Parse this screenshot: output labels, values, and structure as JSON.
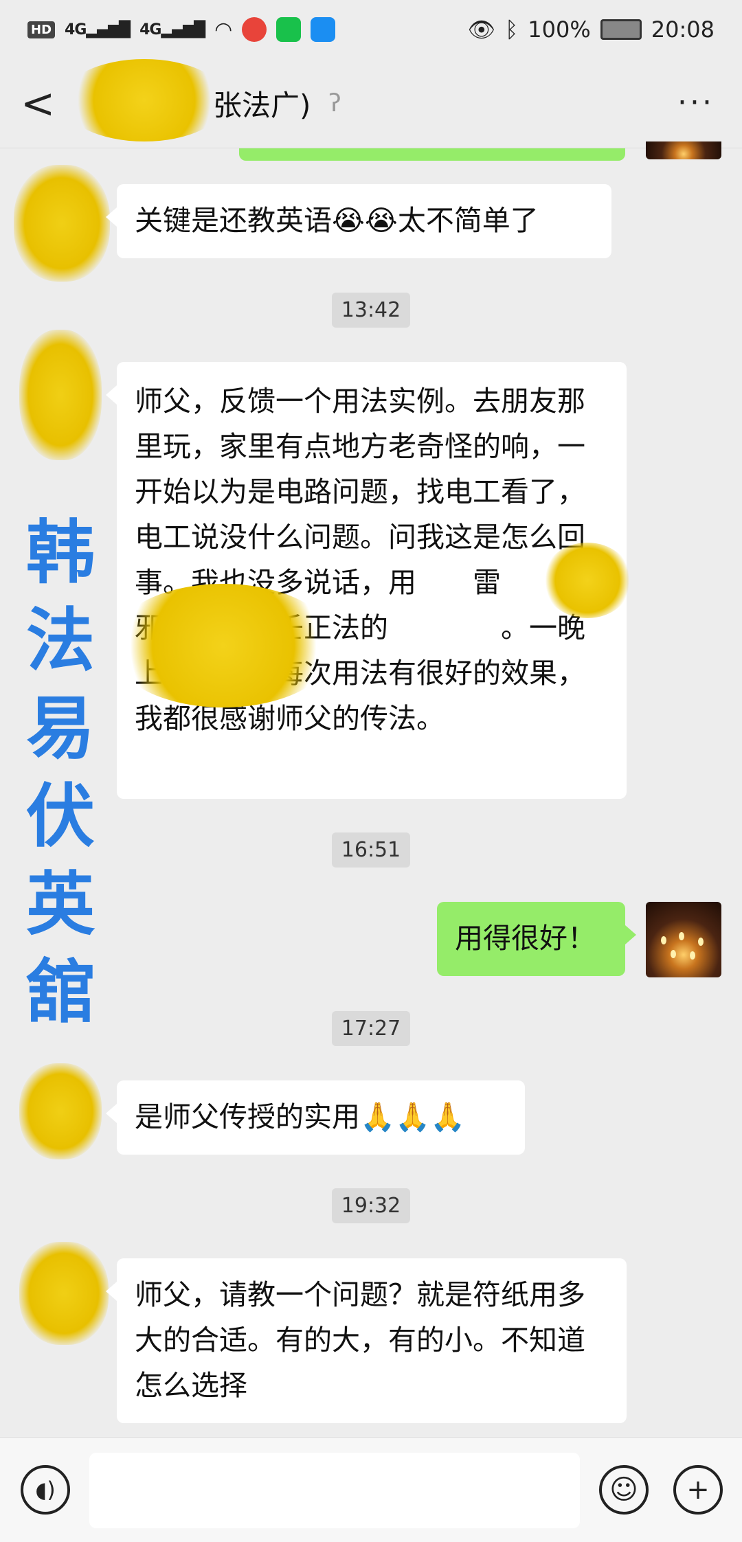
{
  "status_bar": {
    "left_icons": [
      "HD",
      "4G",
      "4G",
      "wifi-icon",
      "app-icon-red",
      "app-icon-iqiyi",
      "app-icon-blue"
    ],
    "battery": "100%",
    "time": "20:08"
  },
  "header": {
    "back_label": "<",
    "title": "张法广)",
    "more_label": "···"
  },
  "messages": [
    {
      "type": "text",
      "side": "left",
      "text": "关键是还教英语😭😭太不简单了"
    },
    {
      "type": "time",
      "text": "13:42"
    },
    {
      "type": "text",
      "side": "left",
      "text": "师父，反馈一个用法实例。去朋友那里玩，家里有点地方老奇怪的响，一开始以为是电路问题，找电工看了，电工说没什么问题。问我这是怎么回事。我也没多说话，用　　雷　　邪，又用六壬正法的　　　　。一晚上也没响。每次用法有很好的效果，我都很感谢师父的传法。"
    },
    {
      "type": "time",
      "text": "16:51"
    },
    {
      "type": "text",
      "side": "right",
      "text": "用得很好！"
    },
    {
      "type": "time",
      "text": "17:27"
    },
    {
      "type": "text",
      "side": "left",
      "text": "是师父传授的实用🙏🙏🙏"
    },
    {
      "type": "time",
      "text": "19:32"
    },
    {
      "type": "text",
      "side": "left",
      "text": "师父，请教一个问题？就是符纸用多大的合适。有的大，有的小。不知道怎么选择"
    }
  ],
  "watermark": [
    "韩",
    "法",
    "易",
    "伏",
    "英",
    "舘"
  ],
  "input_bar": {
    "voice_icon": "voice-icon",
    "emoji_icon": "emoji-icon",
    "add_icon": "plus-icon",
    "input_value": ""
  }
}
